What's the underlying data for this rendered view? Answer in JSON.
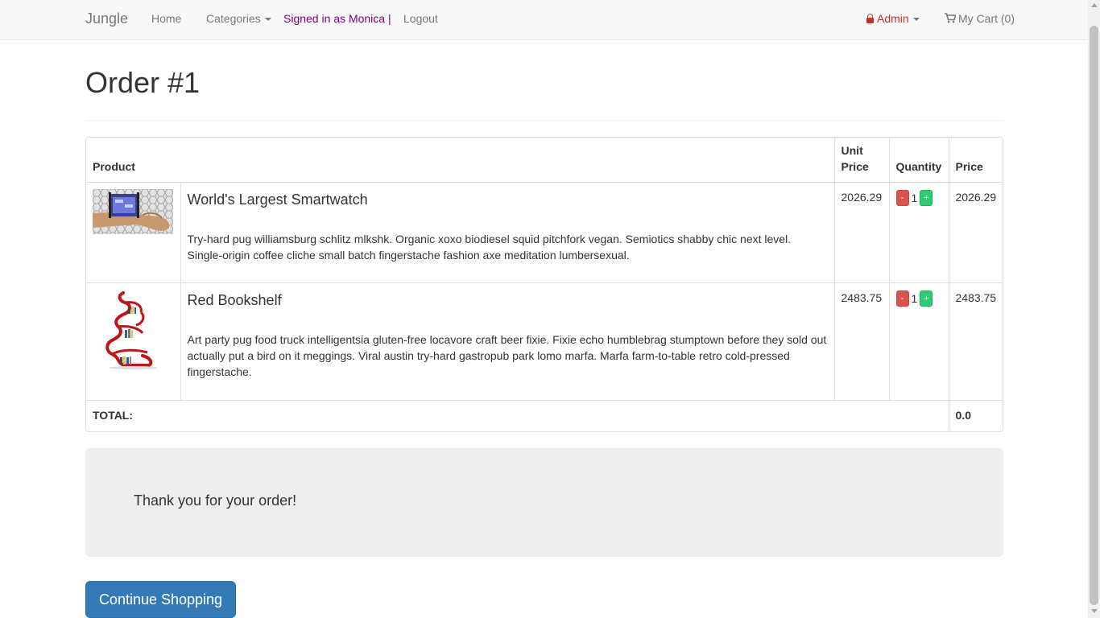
{
  "navbar": {
    "brand": "Jungle",
    "home": "Home",
    "categories": "Categories",
    "signed_in": "Signed in as Monica |",
    "logout": "Logout",
    "admin": "Admin",
    "cart": "My Cart (0)"
  },
  "page": {
    "title": "Order #1"
  },
  "table": {
    "headers": {
      "product": "Product",
      "unit_price_line1": "Unit",
      "unit_price_line2": "Price",
      "quantity": "Quantity",
      "price": "Price"
    },
    "items": [
      {
        "name": "World's Largest Smartwatch",
        "description": "Try-hard pug williamsburg schlitz mlkshk. Organic xoxo biodiesel squid pitchfork vegan. Semiotics shabby chic next level. Single-origin coffee cliche small batch fingerstache fashion axe meditation lumbersexual.",
        "unit_price": "2026.29",
        "quantity": "1",
        "price": "2026.29",
        "minus": "-",
        "plus": "+"
      },
      {
        "name": "Red Bookshelf",
        "description": "Art party pug food truck intelligentsia gluten-free locavore craft beer fixie. Fixie echo humblebrag stumptown before they sold out actually put a bird on it meggings. Viral austin try-hard gastropub park lomo marfa. Marfa farm-to-table retro cold-pressed fingerstache.",
        "unit_price": "2483.75",
        "quantity": "1",
        "price": "2483.75",
        "minus": "-",
        "plus": "+"
      }
    ],
    "total_label": "TOTAL:",
    "total_value": "0.0"
  },
  "thanks": {
    "message": "Thank you for your order!"
  },
  "actions": {
    "continue": "Continue Shopping"
  },
  "colors": {
    "primary": "#337ab7",
    "danger": "#d9534f",
    "success": "#2ecc71",
    "signed_in": "#800080",
    "admin": "#c9302c"
  }
}
